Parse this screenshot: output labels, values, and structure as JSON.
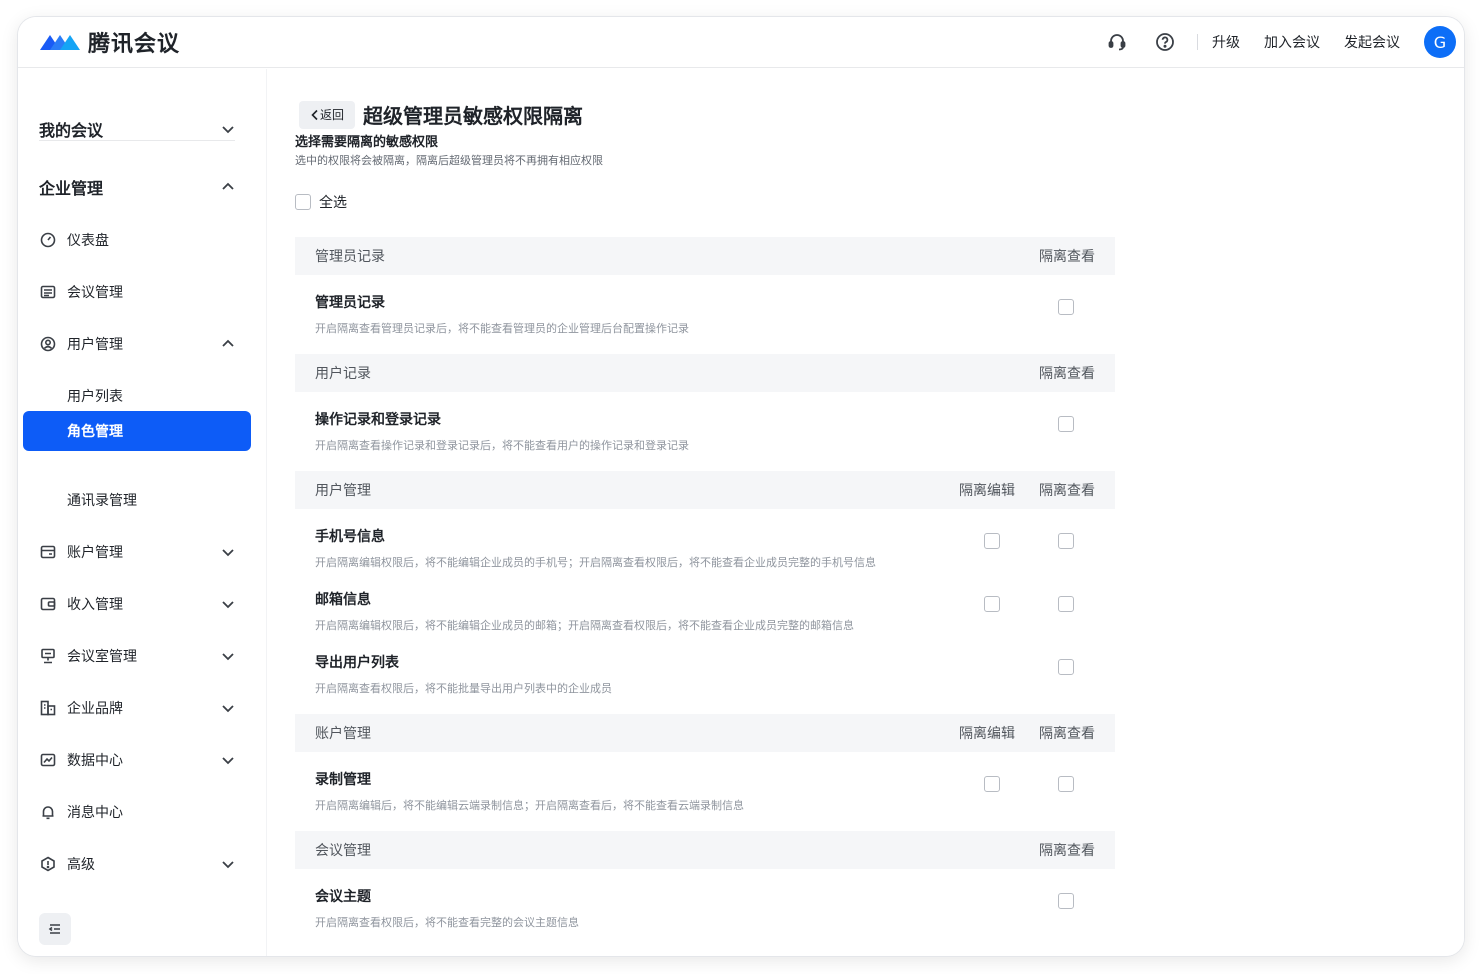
{
  "app": {
    "title": "腾讯会议"
  },
  "topbar": {
    "upgrade": "升级",
    "join": "加入会议",
    "start": "发起会议",
    "avatar_letter": "G",
    "icons": [
      "headset-icon",
      "help-circle-icon"
    ]
  },
  "sidebar": {
    "my_meetings": "我的会议",
    "enterprise": "企业管理",
    "items": [
      {
        "label": "仪表盘",
        "icon": "dashboard-icon"
      },
      {
        "label": "会议管理",
        "icon": "list-icon"
      },
      {
        "label": "用户管理",
        "icon": "user-circle-icon",
        "expanded": true
      },
      {
        "label": "账户管理",
        "icon": "card-icon"
      },
      {
        "label": "收入管理",
        "icon": "wallet-icon"
      },
      {
        "label": "会议室管理",
        "icon": "meeting-room-icon"
      },
      {
        "label": "企业品牌",
        "icon": "building-icon"
      },
      {
        "label": "数据中心",
        "icon": "chart-icon"
      },
      {
        "label": "消息中心",
        "icon": "bell-icon"
      },
      {
        "label": "高级",
        "icon": "advanced-icon"
      }
    ],
    "sub_items": [
      "用户列表",
      "角色管理",
      "通讯录管理"
    ],
    "active": "角色管理"
  },
  "page": {
    "back_label": "返回",
    "title": "超级管理员敏感权限隔离",
    "section_title": "选择需要隔离的敏感权限",
    "section_desc": "选中的权限将会被隔离，隔离后超级管理员将不再拥有相应权限",
    "select_all": "全选"
  },
  "columns": {
    "edit": "隔离编辑",
    "view": "隔离查看"
  },
  "groups": [
    {
      "name": "管理员记录",
      "has_edit": false,
      "items": [
        {
          "title": "管理员记录",
          "desc": "开启隔离查看管理员记录后，将不能查看管理员的企业管理后台配置操作记录",
          "edit": false,
          "view": false
        }
      ]
    },
    {
      "name": "用户记录",
      "has_edit": false,
      "items": [
        {
          "title": "操作记录和登录记录",
          "desc": "开启隔离查看操作记录和登录记录后，将不能查看用户的操作记录和登录记录",
          "edit": false,
          "view": false
        }
      ]
    },
    {
      "name": "用户管理",
      "has_edit": true,
      "items": [
        {
          "title": "手机号信息",
          "desc": "开启隔离编辑权限后，将不能编辑企业成员的手机号；开启隔离查看权限后，将不能查看企业成员完整的手机号信息",
          "edit": false,
          "view": false
        },
        {
          "title": "邮箱信息",
          "desc": "开启隔离编辑权限后，将不能编辑企业成员的邮箱；开启隔离查看权限后，将不能查看企业成员完整的邮箱信息",
          "edit": false,
          "view": false
        },
        {
          "title": "导出用户列表",
          "desc": "开启隔离查看权限后，将不能批量导出用户列表中的企业成员",
          "view": false
        }
      ]
    },
    {
      "name": "账户管理",
      "has_edit": true,
      "items": [
        {
          "title": "录制管理",
          "desc": "开启隔离编辑后，将不能编辑云端录制信息；开启隔离查看后，将不能查看云端录制信息",
          "edit": false,
          "view": false
        }
      ]
    },
    {
      "name": "会议管理",
      "has_edit": false,
      "items": [
        {
          "title": "会议主题",
          "desc": "开启隔离查看权限后，将不能查看完整的会议主题信息",
          "view": false
        }
      ]
    }
  ]
}
